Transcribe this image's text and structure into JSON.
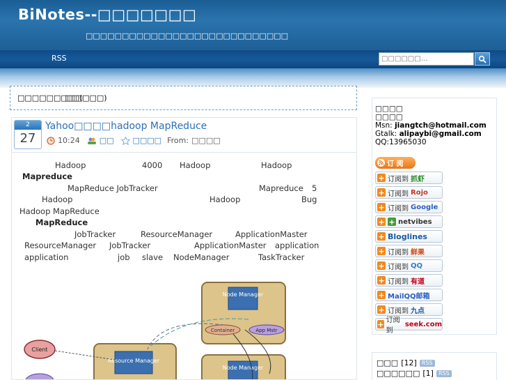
{
  "header": {
    "site_title": "BiNotes--□□□□□□□",
    "site_description": "□□□□□□□□□□□□□□□□□□□□□□□□□□□□"
  },
  "nav": {
    "rss_label": "RSS",
    "search_placeholder": "□□□□□□…"
  },
  "breadcrumb": {
    "left": "□□□□□□□□□",
    "right": "□□(□□□)"
  },
  "post": {
    "month": "2",
    "day": "27",
    "title": "Yahoo□□□□hadoop MapReduce",
    "time": "10:24",
    "author": "□□",
    "category": "□□□□",
    "from_label": "From:",
    "from_value": "□□□□",
    "body": [
      "Hadoop",
      "4000",
      "Hadoop",
      "Hadoop",
      "Mapreduce",
      "MapReduce JobTracker",
      "Mapreduce",
      "5",
      "Hadoop",
      "Hadoop",
      "Bug",
      "Hadoop MapReduce",
      "MapReduce",
      "JobTracker",
      "ResourceManager",
      "ApplicationMaster",
      "ResourceManager",
      "JobTracker",
      "ApplicationMaster",
      "application",
      "application",
      "job",
      "slave",
      "NodeManager",
      "TaskTracker"
    ],
    "diagram": {
      "client": "Client",
      "resource_manager": "Resource Manager",
      "node_manager_1": "Node Manager",
      "node_manager_2": "Node Manager",
      "container": "Container",
      "app_mstr": "App Mstr"
    }
  },
  "sidebar": {
    "contact_title": "□□□□",
    "contact_subtitle": "□□□□",
    "msn_label": "Msn:",
    "msn_value": "jiangtch@hotmail.com",
    "gtalk_label": "Gtalk:",
    "gtalk_value": "alipaybi@gmail.com",
    "qq": "QQ:13965030",
    "rss_button": "订 阅",
    "subscribe": [
      {
        "prefix": "订阅到",
        "brand": "抓虾",
        "color": "#2a8a2a"
      },
      {
        "prefix": "订阅到",
        "brand": "Rojo",
        "color": "#c0392b"
      },
      {
        "prefix": "订阅到",
        "brand": "Google",
        "color": "#2a5fc4"
      },
      {
        "prefix": "",
        "brand": "netvibes",
        "color": "#333333"
      },
      {
        "prefix": "",
        "brand": "Bloglines",
        "color": "#1a5aa0"
      },
      {
        "prefix": "订阅到",
        "brand": "鲜果",
        "color": "#d04a10"
      },
      {
        "prefix": "订阅到",
        "brand": "QQ",
        "color": "#2a7fc4"
      },
      {
        "prefix": "订阅到",
        "brand": "有道",
        "color": "#c0001a"
      },
      {
        "prefix": "",
        "brand": "MailQQ邮箱",
        "color": "#2a5fc4"
      },
      {
        "prefix": "订阅到",
        "brand": "九点",
        "color": "#1a5aa0"
      },
      {
        "prefix": "订阅到",
        "brand": "seek.com",
        "color": "#c0001a"
      }
    ],
    "categories": [
      {
        "name": "□□□",
        "count": "[12]",
        "rss": "RSS"
      },
      {
        "name": "□□□□□□",
        "count": "[1]",
        "rss": "RSS"
      }
    ]
  },
  "colors": {
    "header_blue": "#1e5f97",
    "link_blue": "#2a70b8",
    "rss_orange": "#e8761a"
  }
}
